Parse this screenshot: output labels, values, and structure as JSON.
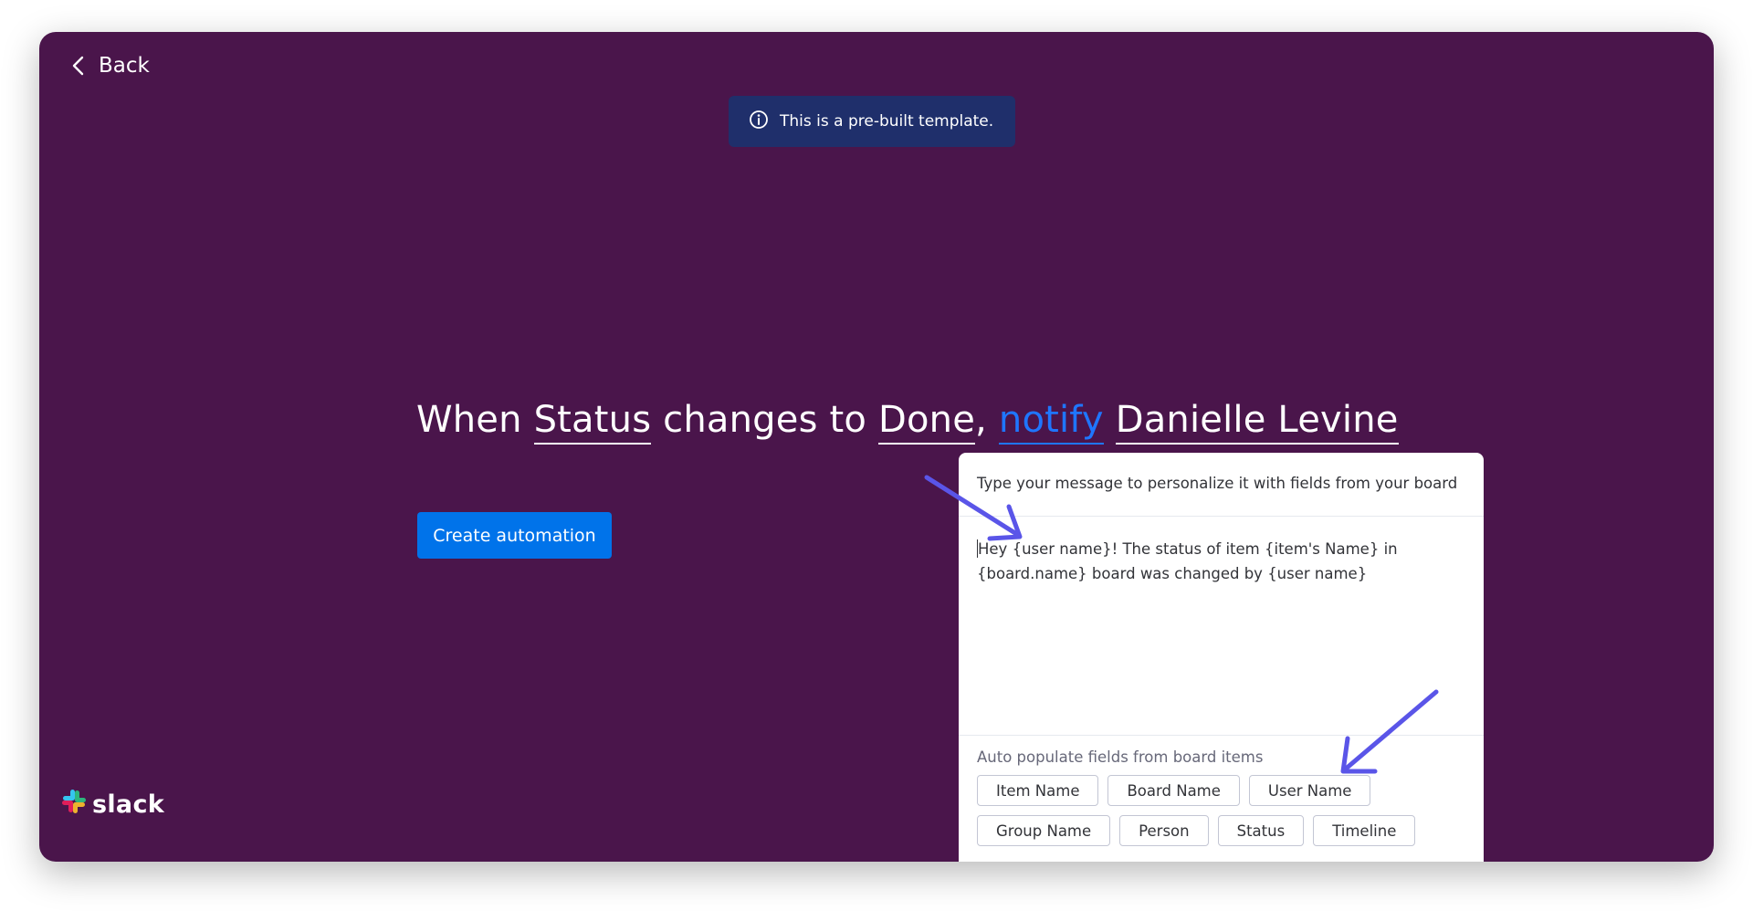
{
  "nav": {
    "back_label": "Back"
  },
  "banner": {
    "icon": "info-icon",
    "text": "This is a pre-built template."
  },
  "sentence": {
    "prefix": "When ",
    "trigger_field": "Status",
    "middle": " changes to ",
    "trigger_value": "Done",
    "comma": ",",
    "action": "notify",
    "recipient": "Danielle Levine"
  },
  "create_button": {
    "label": "Create automation"
  },
  "message_popup": {
    "header": "Type your message to personalize it with fields from your board",
    "message_line1": "Hey {user name}! The status of item {item's Name} in",
    "message_line2": "{board.name} board was changed by {user name}",
    "auto_populate_label": "Auto populate fields from board items",
    "fields": [
      {
        "label": "Item Name"
      },
      {
        "label": "Board Name"
      },
      {
        "label": "User Name"
      },
      {
        "label": "Group Name"
      },
      {
        "label": "Person"
      },
      {
        "label": "Status"
      },
      {
        "label": "Timeline"
      }
    ]
  },
  "brand": {
    "logo_text": "slack",
    "icon": "slack-logo-icon"
  },
  "colors": {
    "background": "#4a154b",
    "banner": "#1f2f6b",
    "primary": "#0073ea",
    "accent_link": "#1f76ff",
    "annotation_arrow": "#5a55e8"
  }
}
